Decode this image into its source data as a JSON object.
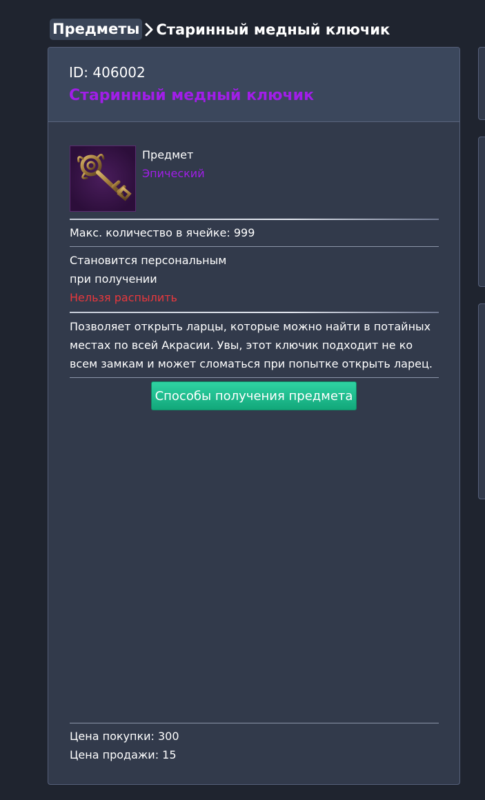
{
  "breadcrumb": {
    "parent": "Предметы",
    "current": "Старинный медный ключик"
  },
  "item": {
    "id_label": "ID: 406002",
    "name": "Старинный медный ключик",
    "type": "Предмет",
    "rarity": "Эпический",
    "stack": "Макс. количество в ячейке: 999",
    "bind_line1": "Становится персональным",
    "bind_line2": "при получении",
    "no_dismantle": "Нельзя распылить",
    "description": "Позволяет открыть ларцы, которые можно найти в потайных местах по всей Акрасии. Увы, этот ключик подходит не ко всем замкам и может сломаться при попытке открыть ларец.",
    "obtain_button": "Способы получения предмета",
    "buy_price": "Цена покупки: 300",
    "sell_price": "Цена продажи: 15"
  },
  "colors": {
    "epic": "#a11ee8",
    "warning": "#e8383d",
    "accent_button": "#1fbf8e"
  },
  "icons": {
    "item_icon": "antique-bronze-key-icon",
    "breadcrumb_separator": "chevron-right-icon"
  }
}
